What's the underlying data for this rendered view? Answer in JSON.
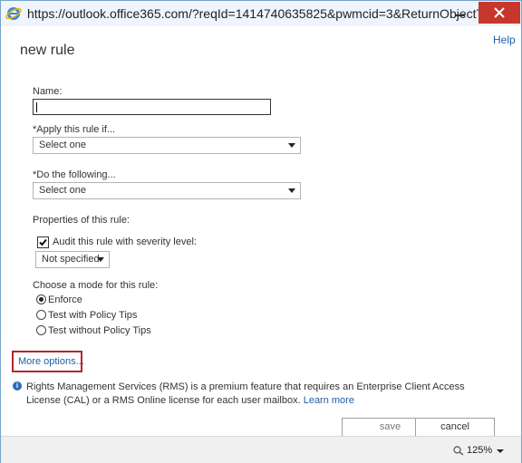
{
  "browser": {
    "url": "https://outlook.office365.com/?reqId=1414740635825&pwmcid=3&ReturnObjectTyp..."
  },
  "dialog": {
    "help": "Help",
    "title": "new rule",
    "name_label": "Name:",
    "name_value": "",
    "apply_label": "*Apply this rule if...",
    "apply_value": "Select one",
    "do_label": "*Do the following...",
    "do_value": "Select one",
    "properties_label": "Properties of this rule:",
    "audit_label": "Audit this rule with severity level:",
    "audit_checked": true,
    "severity_value": "Not specified",
    "mode_label": "Choose a mode for this rule:",
    "modes": [
      "Enforce",
      "Test with Policy Tips",
      "Test without Policy Tips"
    ],
    "selected_mode": "Enforce",
    "more_options": "More options...",
    "info_text": "Rights Management Services (RMS) is a premium feature that requires an Enterprise Client Access License (CAL) or a RMS Online license for each user mailbox.",
    "learn_more": "Learn more",
    "save": "save",
    "cancel": "cancel"
  },
  "status_bar": {
    "zoom": "125%"
  },
  "colors": {
    "link": "#1f5fa8",
    "highlight_border": "#b4262b",
    "close_button": "#c7372b"
  }
}
